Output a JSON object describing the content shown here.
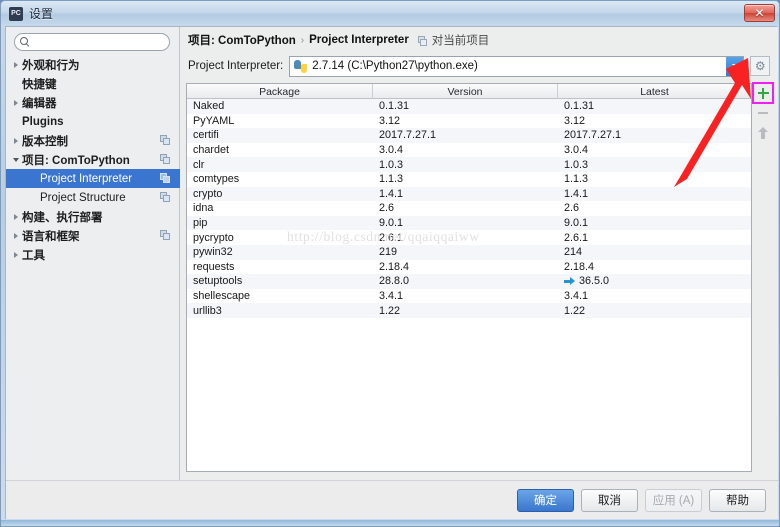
{
  "window": {
    "title": "设置",
    "app_icon": "pycharm-icon",
    "close_label": "✕"
  },
  "sidebar": {
    "search": {
      "value": "",
      "placeholder": ""
    },
    "items": [
      {
        "label": "外观和行为",
        "arrow": "right",
        "bold": true,
        "indent": false,
        "copy": false,
        "selected": false
      },
      {
        "label": "快捷键",
        "arrow": "none",
        "bold": true,
        "indent": false,
        "copy": false,
        "selected": false
      },
      {
        "label": "编辑器",
        "arrow": "right",
        "bold": true,
        "indent": false,
        "copy": false,
        "selected": false
      },
      {
        "label": "Plugins",
        "arrow": "none",
        "bold": true,
        "indent": false,
        "copy": false,
        "selected": false
      },
      {
        "label": "版本控制",
        "arrow": "right",
        "bold": true,
        "indent": false,
        "copy": true,
        "selected": false
      },
      {
        "label": "项目: ComToPython",
        "arrow": "down",
        "bold": true,
        "indent": false,
        "copy": true,
        "selected": false
      },
      {
        "label": "Project Interpreter",
        "arrow": "none",
        "bold": false,
        "indent": true,
        "copy": true,
        "selected": true
      },
      {
        "label": "Project Structure",
        "arrow": "none",
        "bold": false,
        "indent": true,
        "copy": true,
        "selected": false
      },
      {
        "label": "构建、执行部署",
        "arrow": "right",
        "bold": true,
        "indent": false,
        "copy": false,
        "selected": false
      },
      {
        "label": "语言和框架",
        "arrow": "right",
        "bold": true,
        "indent": false,
        "copy": true,
        "selected": false
      },
      {
        "label": "工具",
        "arrow": "right",
        "bold": true,
        "indent": false,
        "copy": false,
        "selected": false
      }
    ]
  },
  "main": {
    "breadcrumb": {
      "part1": "项目: ComToPython",
      "separator": "›",
      "part2": "Project Interpreter",
      "scope_label": "对当前项目"
    },
    "interpreter": {
      "label": "Project Interpreter:",
      "value": "2.7.14 (C:\\Python27\\python.exe)",
      "gear_glyph": "⚙"
    },
    "table": {
      "columns": [
        "Package",
        "Version",
        "Latest"
      ],
      "rows": [
        {
          "package": "Naked",
          "version": "0.1.31",
          "latest": "0.1.31",
          "upgrade": false
        },
        {
          "package": "PyYAML",
          "version": "3.12",
          "latest": "3.12",
          "upgrade": false
        },
        {
          "package": "certifi",
          "version": "2017.7.27.1",
          "latest": "2017.7.27.1",
          "upgrade": false
        },
        {
          "package": "chardet",
          "version": "3.0.4",
          "latest": "3.0.4",
          "upgrade": false
        },
        {
          "package": "clr",
          "version": "1.0.3",
          "latest": "1.0.3",
          "upgrade": false
        },
        {
          "package": "comtypes",
          "version": "1.1.3",
          "latest": "1.1.3",
          "upgrade": false
        },
        {
          "package": "crypto",
          "version": "1.4.1",
          "latest": "1.4.1",
          "upgrade": false
        },
        {
          "package": "idna",
          "version": "2.6",
          "latest": "2.6",
          "upgrade": false
        },
        {
          "package": "pip",
          "version": "9.0.1",
          "latest": "9.0.1",
          "upgrade": false
        },
        {
          "package": "pycrypto",
          "version": "2.6.1",
          "latest": "2.6.1",
          "upgrade": false
        },
        {
          "package": "pywin32",
          "version": "219",
          "latest": "214",
          "upgrade": false
        },
        {
          "package": "requests",
          "version": "2.18.4",
          "latest": "2.18.4",
          "upgrade": false
        },
        {
          "package": "setuptools",
          "version": "28.8.0",
          "latest": "36.5.0",
          "upgrade": true
        },
        {
          "package": "shellescape",
          "version": "3.4.1",
          "latest": "3.4.1",
          "upgrade": false
        },
        {
          "package": "urllib3",
          "version": "1.22",
          "latest": "1.22",
          "upgrade": false
        }
      ]
    },
    "side_tools": [
      {
        "name": "add-package-button",
        "icon": "plus-icon",
        "highlighted": true
      },
      {
        "name": "remove-package-button",
        "icon": "minus-icon",
        "highlighted": false
      },
      {
        "name": "upgrade-package-button",
        "icon": "up-arrow-icon",
        "highlighted": false
      }
    ],
    "watermark": "http://blog.csdn.net/qqaiqqaiww"
  },
  "footer": {
    "buttons": [
      {
        "label": "确定",
        "style": "primary"
      },
      {
        "label": "取消",
        "style": "normal"
      },
      {
        "label": "应用 (A)",
        "style": "disabled"
      },
      {
        "label": "帮助",
        "style": "normal"
      }
    ]
  },
  "colors": {
    "accent": "#3a75d0",
    "highlight_outline": "#f01ef0",
    "plus_green": "#2fa83f",
    "upgrade_blue": "#2196d4",
    "annotation_red": "#f82222"
  }
}
